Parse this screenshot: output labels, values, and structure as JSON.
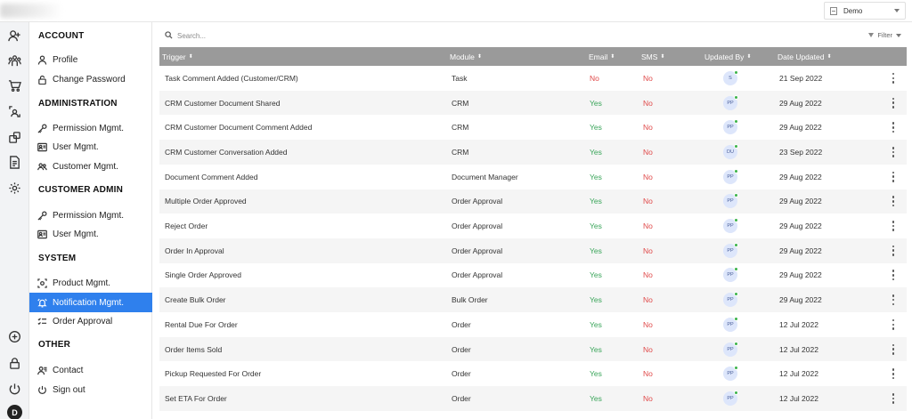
{
  "topbar": {
    "tenant_label": "Demo"
  },
  "rail": {
    "top_icons": [
      "add-user-icon",
      "organization-icon",
      "cart-icon",
      "user-sync-icon",
      "box-icon",
      "document-icon",
      "gear-icon"
    ],
    "bottom_icons": [
      "add-circle-icon",
      "lock-icon",
      "power-icon"
    ],
    "avatar_letter": "D"
  },
  "menu": {
    "sections": [
      {
        "title": "ACCOUNT",
        "items": [
          {
            "label": "Profile",
            "icon": "person-icon"
          },
          {
            "label": "Change Password",
            "icon": "lock-icon"
          }
        ]
      },
      {
        "title": "ADMINISTRATION",
        "items": [
          {
            "label": "Permission Mgmt.",
            "icon": "key-icon"
          },
          {
            "label": "User Mgmt.",
            "icon": "id-card-icon"
          },
          {
            "label": "Customer Mgmt.",
            "icon": "users-icon"
          }
        ]
      },
      {
        "title": "CUSTOMER ADMIN",
        "items": [
          {
            "label": "Permission Mgmt.",
            "icon": "key-icon"
          },
          {
            "label": "User Mgmt.",
            "icon": "id-card-icon"
          }
        ]
      },
      {
        "title": "SYSTEM",
        "items": [
          {
            "label": "Product Mgmt.",
            "icon": "product-icon"
          },
          {
            "label": "Notification Mgmt.",
            "icon": "bell-icon",
            "active": true
          },
          {
            "label": "Order Approval",
            "icon": "checklist-icon"
          }
        ]
      },
      {
        "title": "OTHER",
        "items": [
          {
            "label": "Contact",
            "icon": "contact-icon"
          },
          {
            "label": "Sign out",
            "icon": "power-icon"
          }
        ]
      }
    ]
  },
  "toolbar": {
    "search_placeholder": "Search...",
    "filter_label": "Filter"
  },
  "table": {
    "columns": [
      "Trigger",
      "Module",
      "Email",
      "SMS",
      "Updated By",
      "Date Updated"
    ],
    "rows": [
      {
        "trigger": "Task Comment Added (Customer/CRM)",
        "module": "Task",
        "email": "No",
        "sms": "No",
        "updated_by": "S",
        "date": "21 Sep 2022"
      },
      {
        "trigger": "CRM Customer Document Shared",
        "module": "CRM",
        "email": "Yes",
        "sms": "No",
        "updated_by": "PP",
        "date": "29 Aug 2022"
      },
      {
        "trigger": "CRM Customer Document Comment Added",
        "module": "CRM",
        "email": "Yes",
        "sms": "No",
        "updated_by": "PP",
        "date": "29 Aug 2022"
      },
      {
        "trigger": "CRM Customer Conversation Added",
        "module": "CRM",
        "email": "Yes",
        "sms": "No",
        "updated_by": "DU",
        "date": "23 Sep 2022"
      },
      {
        "trigger": "Document Comment Added",
        "module": "Document Manager",
        "email": "Yes",
        "sms": "No",
        "updated_by": "PP",
        "date": "29 Aug 2022"
      },
      {
        "trigger": "Multiple Order Approved",
        "module": "Order Approval",
        "email": "Yes",
        "sms": "No",
        "updated_by": "PP",
        "date": "29 Aug 2022"
      },
      {
        "trigger": "Reject Order",
        "module": "Order Approval",
        "email": "Yes",
        "sms": "No",
        "updated_by": "PP",
        "date": "29 Aug 2022"
      },
      {
        "trigger": "Order In Approval",
        "module": "Order Approval",
        "email": "Yes",
        "sms": "No",
        "updated_by": "PP",
        "date": "29 Aug 2022"
      },
      {
        "trigger": "Single Order Approved",
        "module": "Order Approval",
        "email": "Yes",
        "sms": "No",
        "updated_by": "PP",
        "date": "29 Aug 2022"
      },
      {
        "trigger": "Create Bulk Order",
        "module": "Bulk Order",
        "email": "Yes",
        "sms": "No",
        "updated_by": "PP",
        "date": "29 Aug 2022"
      },
      {
        "trigger": "Rental Due For Order",
        "module": "Order",
        "email": "Yes",
        "sms": "No",
        "updated_by": "PP",
        "date": "12 Jul 2022"
      },
      {
        "trigger": "Order Items Sold",
        "module": "Order",
        "email": "Yes",
        "sms": "No",
        "updated_by": "PP",
        "date": "12 Jul 2022"
      },
      {
        "trigger": "Pickup Requested For Order",
        "module": "Order",
        "email": "Yes",
        "sms": "No",
        "updated_by": "PP",
        "date": "12 Jul 2022"
      },
      {
        "trigger": "Set ETA For Order",
        "module": "Order",
        "email": "Yes",
        "sms": "No",
        "updated_by": "PP",
        "date": "12 Jul 2022"
      }
    ]
  },
  "colors": {
    "accent": "#2f80ed",
    "yes": "#3aa55a",
    "no": "#e04a4a",
    "header_bg": "#9a9a9a",
    "online": "#3cb34a"
  }
}
